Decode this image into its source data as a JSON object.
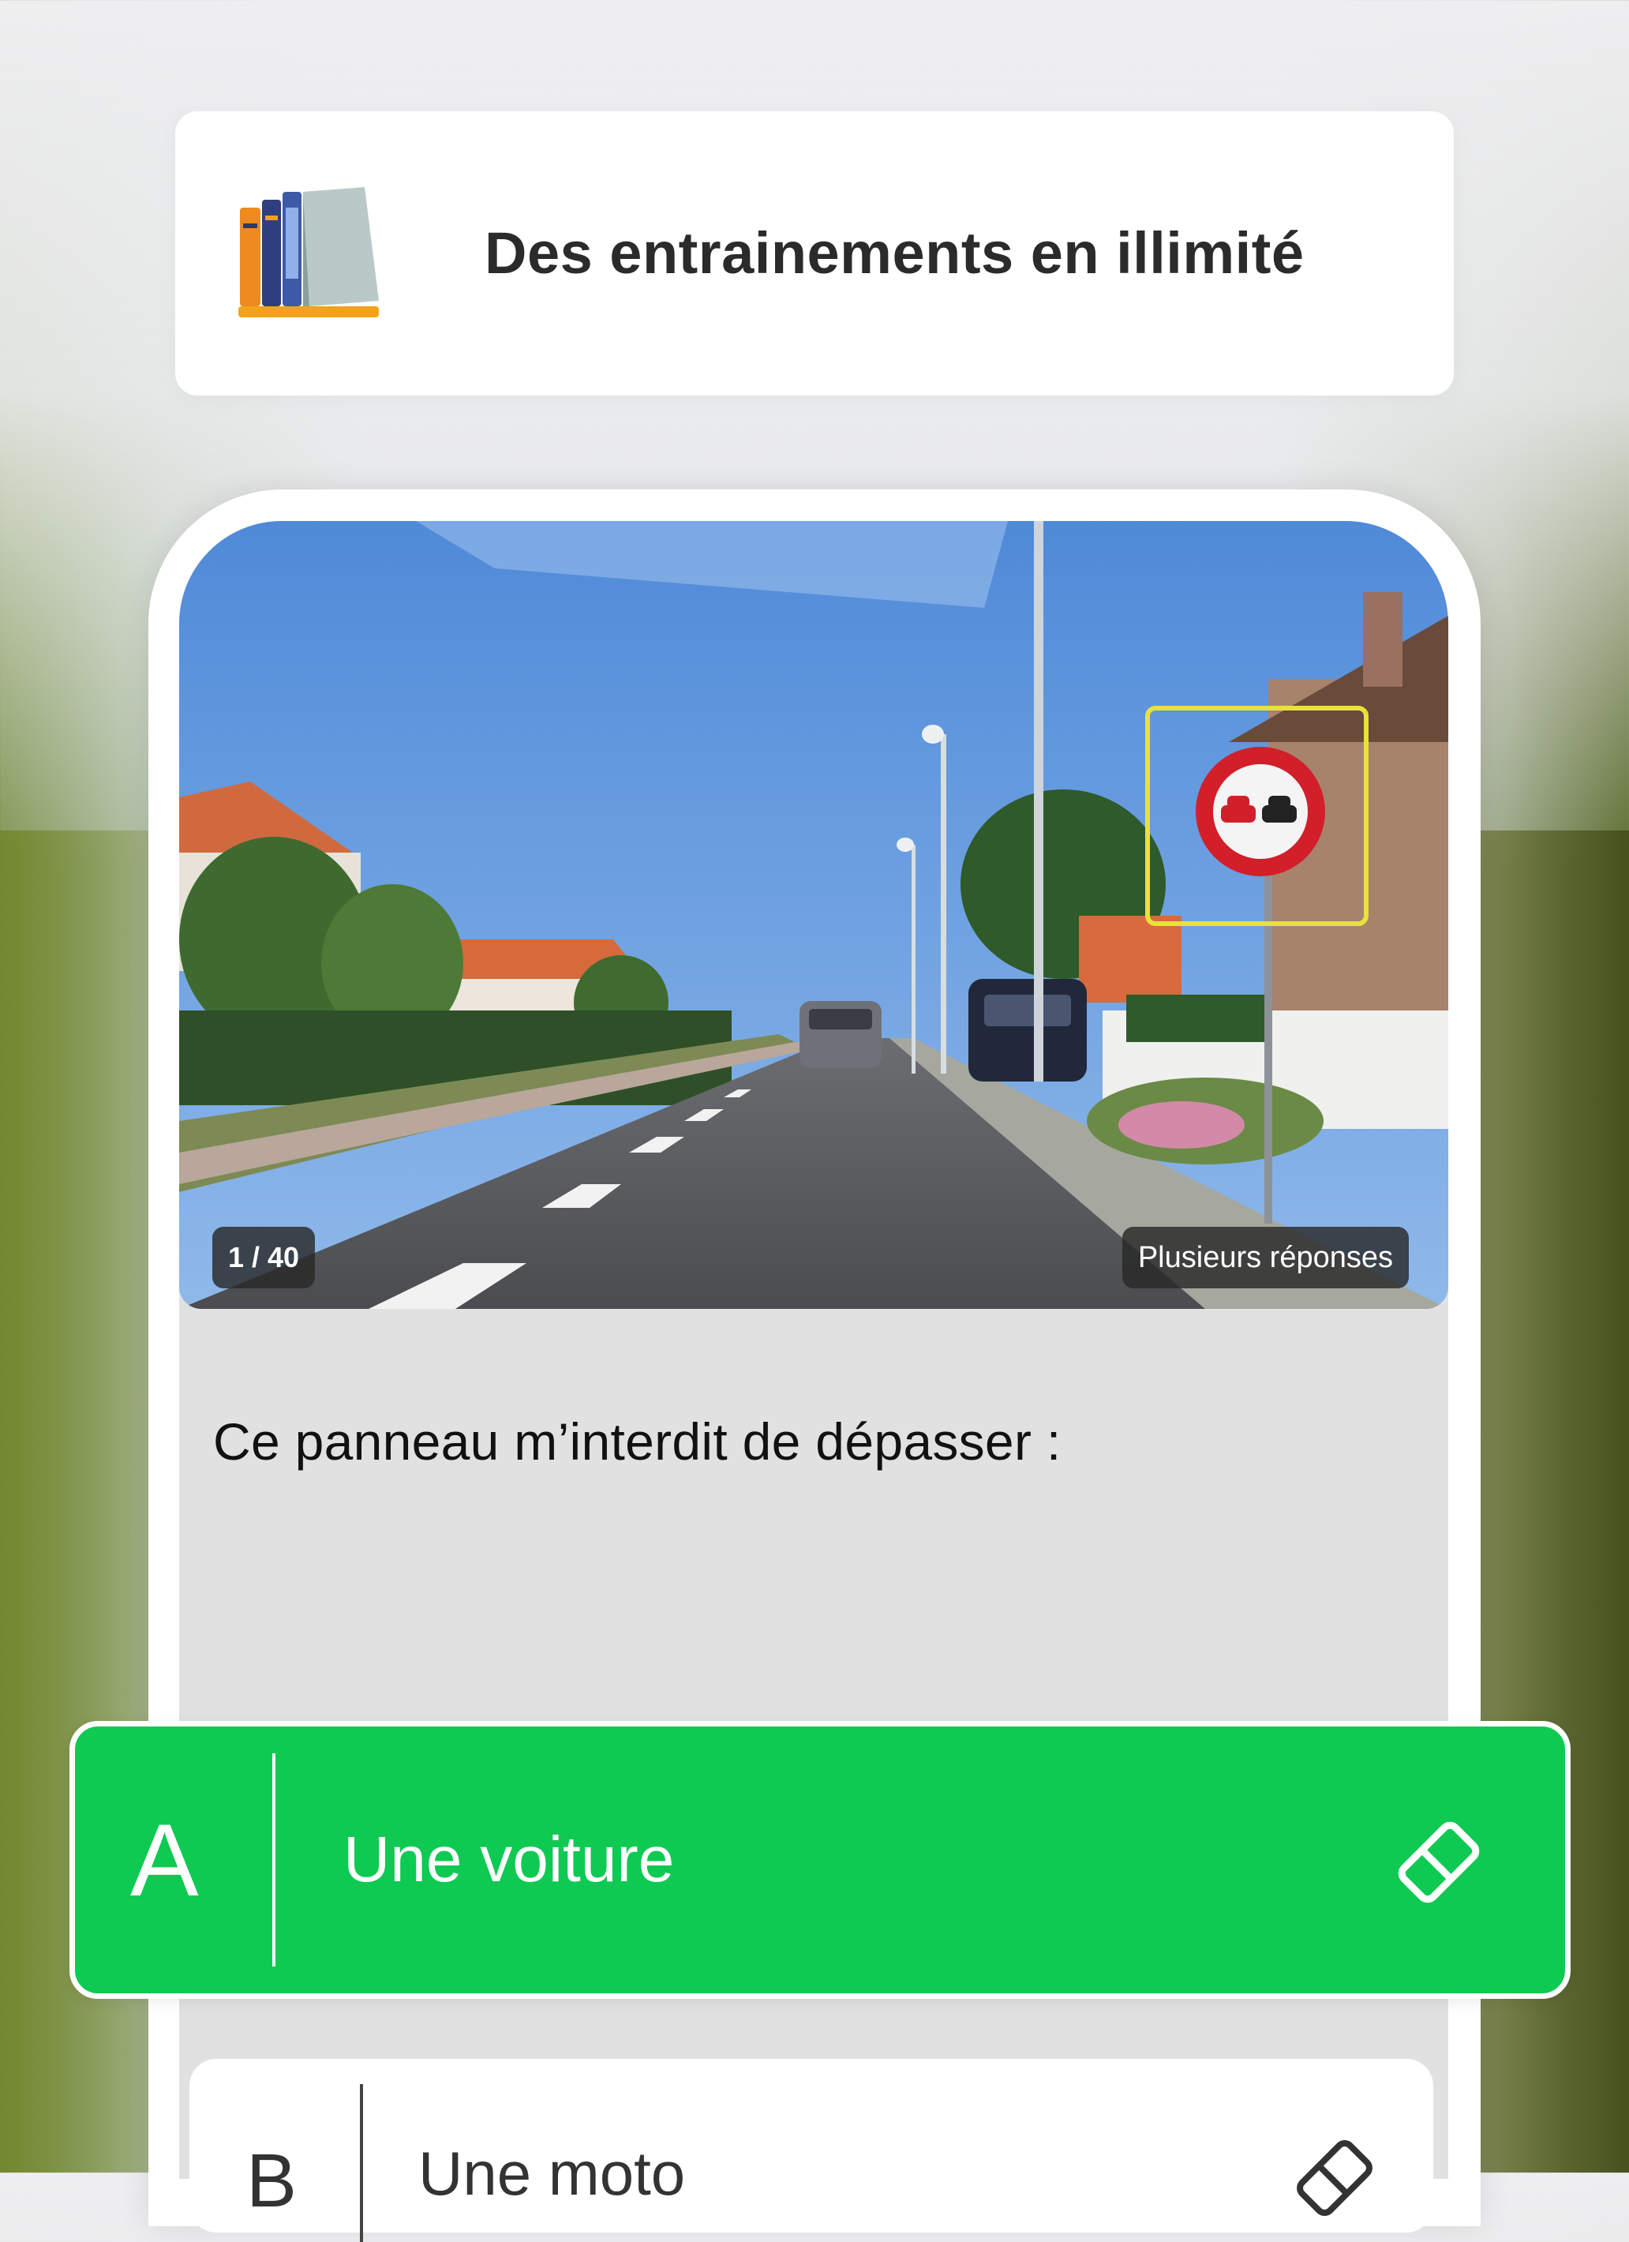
{
  "banner": {
    "icon": "books-icon",
    "title": "Des entrainements en illimité"
  },
  "question_screen": {
    "progress_label": "1 / 40",
    "question_type": "Plusieurs réponses",
    "question_text": "Ce panneau m’interdit de dépasser :",
    "answers": [
      {
        "letter": "A",
        "label": "Une voiture",
        "selected": true,
        "icon": "eraser-icon"
      },
      {
        "letter": "B",
        "label": "Une moto",
        "selected": false,
        "icon": "eraser-icon"
      }
    ]
  },
  "colors": {
    "selected_answer": "#0fca52",
    "sign_red": "#d21f2a",
    "highlight_box": "#e8e23a"
  }
}
